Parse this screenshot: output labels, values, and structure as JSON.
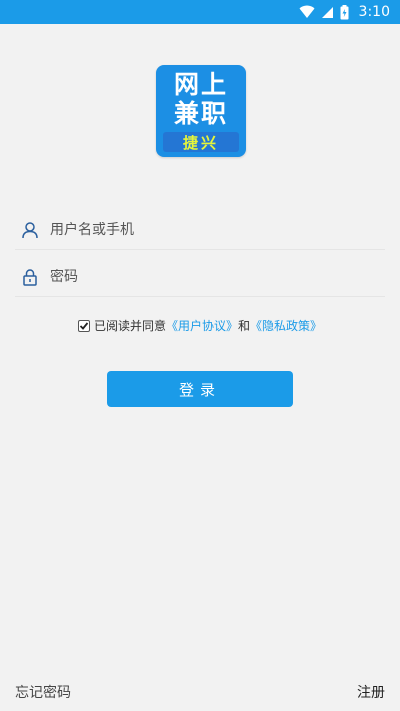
{
  "status_bar": {
    "time": "3:10",
    "icons": [
      "wifi-icon",
      "signal-icon",
      "battery-icon"
    ],
    "background": "#1b9be8"
  },
  "logo": {
    "line1": "网上",
    "line2": "兼职",
    "tag": "捷兴"
  },
  "form": {
    "username_placeholder": "用户名或手机",
    "password_placeholder": "密码"
  },
  "agreement": {
    "checked": true,
    "prefix": "已阅读并同意",
    "user_agreement": "《用户协议》",
    "conjunction": "和",
    "privacy_policy": "《隐私政策》"
  },
  "login_label": "登录",
  "footer": {
    "forgot_password": "忘记密码",
    "register": "注册"
  },
  "colors": {
    "accent": "#1b9be8",
    "background": "#f2f2f2",
    "logo_tag_text": "#e6f53b"
  }
}
